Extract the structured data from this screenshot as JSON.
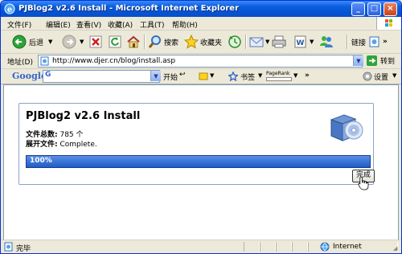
{
  "window": {
    "title": "PJBlog2 v2.6 Install - Microsoft Internet Explorer",
    "minimize": "_",
    "maximize": "□",
    "close": "×"
  },
  "menu": [
    "文件(F)",
    "编辑(E)",
    "查看(V)",
    "收藏(A)",
    "工具(T)",
    "帮助(H)"
  ],
  "toolbar": {
    "back": "后退",
    "search": "搜索",
    "favorites": "收藏夹",
    "links": "链接"
  },
  "address": {
    "label": "地址(D)",
    "url": "http://www.djer.cn/blog/install.asp",
    "go": "转到"
  },
  "google": {
    "logo": "Google",
    "g_button": "G",
    "start": "开始",
    "bookmarks": "书签",
    "pagerank": "PageRank",
    "settings": "设置"
  },
  "install": {
    "title": "PJBlog2 v2.6 Install",
    "total_label": "文件总数:",
    "total_value": "785 个",
    "expand_label": "展开文件:",
    "expand_value": "Complete.",
    "progress_text": "100%",
    "progress": 1.0,
    "finish_button": "完成"
  },
  "status": {
    "text": "完毕",
    "zone": "Internet"
  },
  "colors": {
    "titlebar": "#0653d4",
    "progress": "#1e5cc6"
  }
}
